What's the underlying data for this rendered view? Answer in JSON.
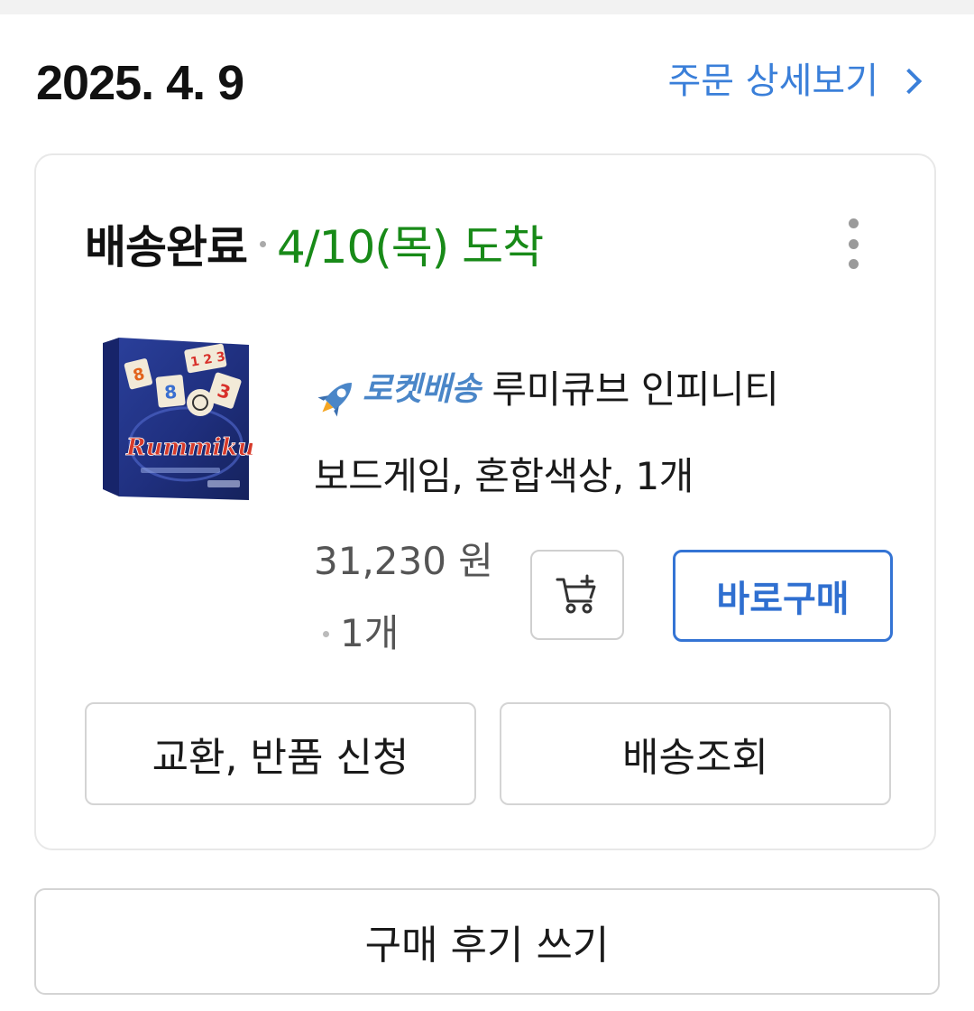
{
  "order": {
    "date": "2025. 4. 9",
    "detail_link_label": "주문 상세보기"
  },
  "delivery": {
    "status": "배송완료",
    "arrival": "4/10(목) 도착"
  },
  "product": {
    "badge": "로켓배송",
    "name_line1": "루미큐브 인피니티",
    "name_line2": "보드게임, 혼합색상, 1개",
    "price": "31,230 원",
    "quantity": "1개",
    "image_logo_text": "Rummikub"
  },
  "buttons": {
    "buy_now": "바로구매",
    "exchange_return": "교환, 반품 신청",
    "tracking": "배송조회",
    "write_review": "구매 후기 쓰기"
  },
  "icons": {
    "rocket": "rocket-icon",
    "cart": "add-to-cart-icon",
    "more": "more-vertical-icon",
    "chevron": "chevron-right-icon"
  },
  "colors": {
    "accent_blue": "#3a7fd9",
    "arrival_green": "#188a18",
    "rocket_blue": "#4a86c8"
  }
}
